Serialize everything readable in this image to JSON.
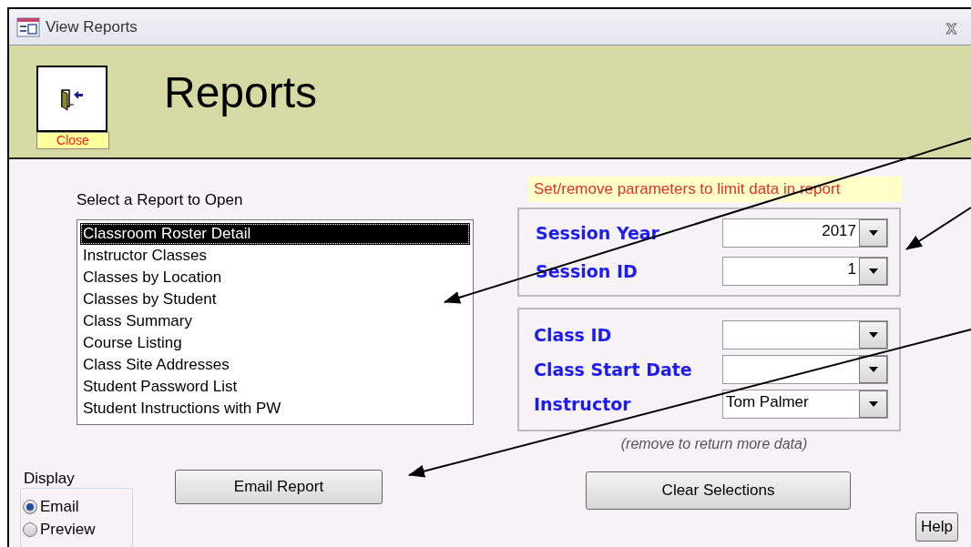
{
  "window": {
    "title": "View Reports",
    "close_glyph": "x"
  },
  "header": {
    "title": "Reports",
    "close_button": "Close"
  },
  "report_list": {
    "label": "Select a Report to Open",
    "items": [
      {
        "label": "Classroom Roster Detail",
        "selected": true
      },
      {
        "label": "Instructor Classes",
        "selected": false
      },
      {
        "label": "Classes by Location",
        "selected": false
      },
      {
        "label": "Classes by Student",
        "selected": false
      },
      {
        "label": "Class Summary",
        "selected": false
      },
      {
        "label": "Course Listing",
        "selected": false
      },
      {
        "label": "Class Site Addresses",
        "selected": false
      },
      {
        "label": "Student Password List",
        "selected": false
      },
      {
        "label": "Student Instructions with PW",
        "selected": false
      }
    ]
  },
  "parameters_hint": "Set/remove parameters to limit data in report",
  "session_group": [
    {
      "label": "Session Year",
      "value": "2017",
      "kind": "number"
    },
    {
      "label": "Session ID",
      "value": "1",
      "kind": "number"
    }
  ],
  "class_group": [
    {
      "label": "Class ID"
    },
    {
      "label": "Class Start Date"
    },
    {
      "label": "Instructor",
      "value": "Tom Palmer"
    }
  ],
  "note": "(remove to return more data)",
  "display": {
    "label": "Display",
    "options": [
      {
        "label": "Email",
        "selected": true
      },
      {
        "label": "Preview",
        "selected": false
      }
    ]
  },
  "buttons": {
    "email_report": "Email Report",
    "clear_selections": "Clear Selections",
    "help": "Help"
  }
}
